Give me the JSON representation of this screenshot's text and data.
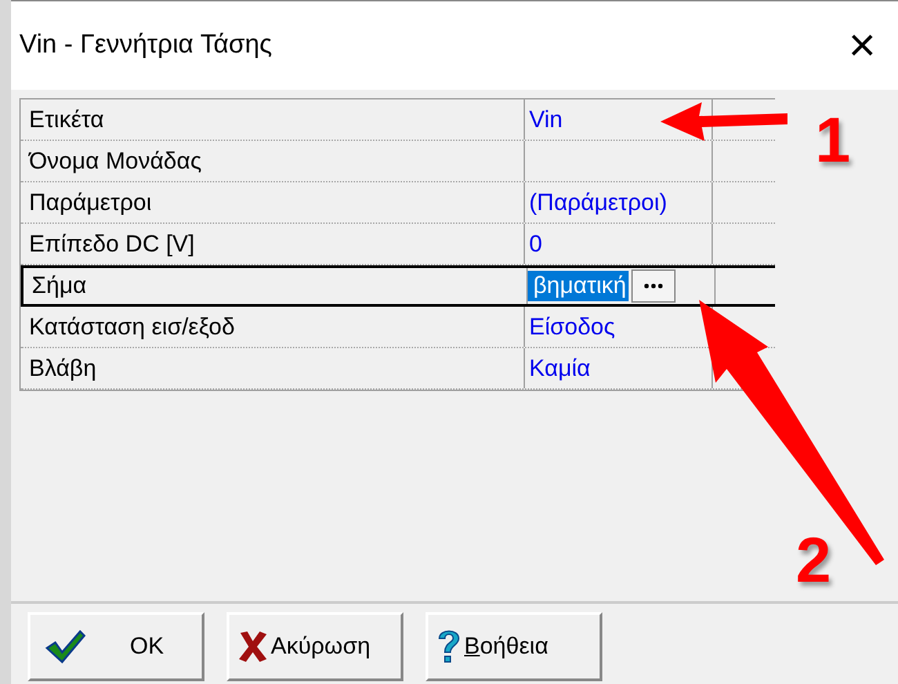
{
  "window": {
    "title": "Vin - Γεννήτρια Τάσης",
    "close": "×"
  },
  "properties": [
    {
      "label": "Ετικέτα",
      "value": "Vin",
      "selected": false
    },
    {
      "label": "Όνομα Μονάδας",
      "selected": false
    },
    {
      "label": "Παράμετροι",
      "value": "(Παράμετροι)",
      "selected": false
    },
    {
      "label": "Επίπεδο DC [V]",
      "value": "0",
      "selected": false
    },
    {
      "label": "Σήμα",
      "value": "βηματική",
      "selected": true
    },
    {
      "label": "Κατάσταση εισ/εξοδ",
      "value": "Είσοδος",
      "selected": false
    },
    {
      "label": "Βλάβη",
      "value": "Καμία",
      "selected": false
    }
  ],
  "buttons": [
    {
      "kind": "ok",
      "label": "OK"
    },
    {
      "kind": "cancel",
      "label": "Ακύρωση"
    },
    {
      "kind": "help",
      "label": "Βοήθεια"
    }
  ],
  "annotations": [
    {
      "label": "1"
    },
    {
      "label": "2"
    }
  ]
}
